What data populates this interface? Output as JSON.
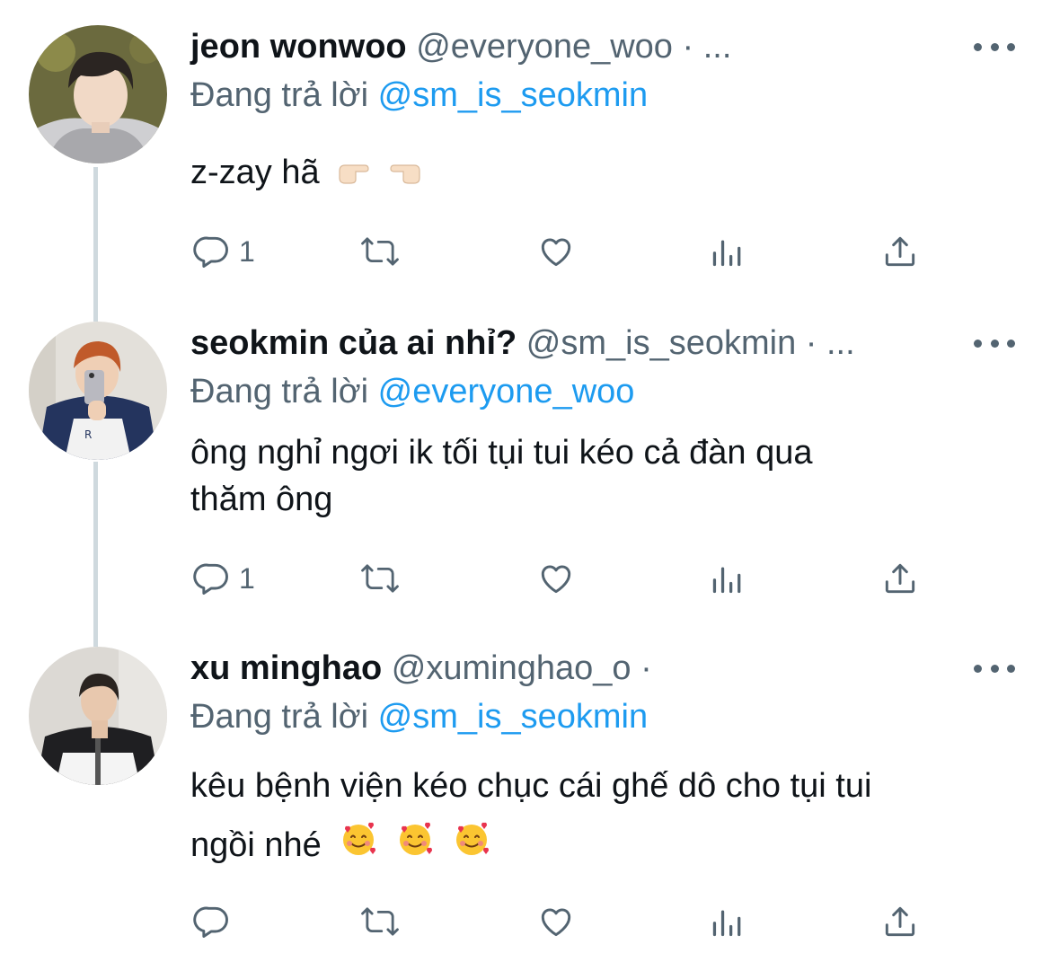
{
  "tweets": [
    {
      "name": "jeon wonwoo",
      "handle": "@everyone_woo",
      "dot": "·",
      "ellipsis": "...",
      "reply_prefix": "Đang trả lời",
      "reply_to": "@sm_is_seokmin",
      "text": "z-zay hã",
      "emojis": [
        "point-right-emoji",
        "point-left-emoji"
      ],
      "reply_count": "1"
    },
    {
      "name": "seokmin của ai nhỉ?",
      "handle": "@sm_is_seokmin",
      "dot": "·",
      "ellipsis": "...",
      "reply_prefix": "Đang trả lời",
      "reply_to": "@everyone_woo",
      "text_line1": "ông nghỉ ngơi ik tối tụi tui kéo cả đàn qua",
      "text_line2": "thăm ông",
      "reply_count": "1"
    },
    {
      "name": "xu minghao",
      "handle": "@xuminghao_o",
      "dot": "·",
      "reply_prefix": "Đang trả lời",
      "reply_to": "@sm_is_seokmin",
      "text_line1": "kêu bệnh viện kéo chục cái ghế dô cho tụi tui",
      "text_line2": "ngồi nhé",
      "emojis": [
        "smiling-face-with-hearts-emoji",
        "smiling-face-with-hearts-emoji",
        "smiling-face-with-hearts-emoji"
      ],
      "reply_count": ""
    }
  ],
  "icons": [
    "more-icon",
    "reply-icon",
    "retweet-icon",
    "like-icon",
    "analytics-icon",
    "share-icon"
  ],
  "colors": {
    "text": "#0f1419",
    "secondary": "#536471",
    "mention": "#1d9bf0",
    "thread_line": "#cfd9de",
    "background": "#ffffff"
  }
}
